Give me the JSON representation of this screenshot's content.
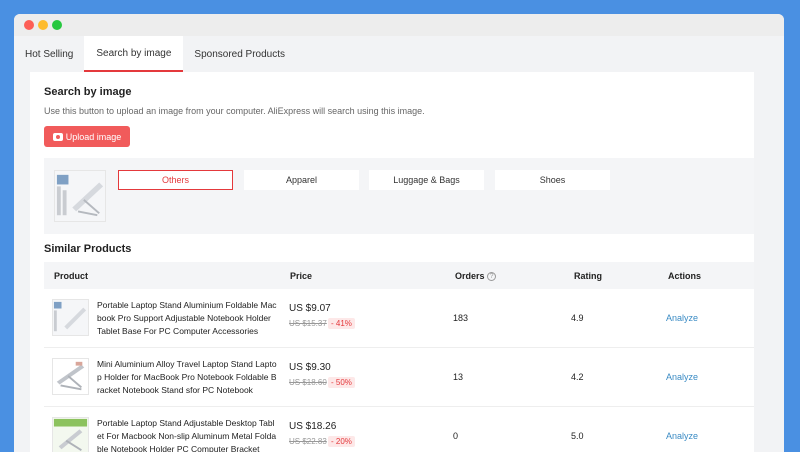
{
  "tabs": [
    {
      "label": "Hot Selling"
    },
    {
      "label": "Search by image"
    },
    {
      "label": "Sponsored Products"
    }
  ],
  "search": {
    "title": "Search by image",
    "description": "Use this button to upload an image from your computer. AliExpress will search using this image.",
    "upload_label": "Upload image"
  },
  "categories": [
    {
      "label": "Others",
      "active": true
    },
    {
      "label": "Apparel"
    },
    {
      "label": "Luggage & Bags"
    },
    {
      "label": "Shoes"
    }
  ],
  "similar": {
    "title": "Similar Products",
    "columns": {
      "product": "Product",
      "price": "Price",
      "orders": "Orders",
      "rating": "Rating",
      "actions": "Actions"
    },
    "rows": [
      {
        "name": "Portable Laptop Stand Aluminium Foldable Macbook Pro Support Adjustable Notebook Holder Tablet Base For PC Computer Accessories",
        "price": "US $9.07",
        "old_price": "US $15.37",
        "discount": "- 41%",
        "orders": "183",
        "rating": "4.9",
        "action": "Analyze"
      },
      {
        "name": "Mini Aluminium Alloy Travel Laptop Stand Laptop Holder for MacBook Pro Notebook Foldable Bracket Notebook Stand sfor PC Notebook",
        "price": "US $9.30",
        "old_price": "US $18.60",
        "discount": "- 50%",
        "orders": "13",
        "rating": "4.2",
        "action": "Analyze"
      },
      {
        "name": "Portable Laptop Stand Adjustable Desktop Tablet For Macbook Non-slip Aluminum Metal Foldable Notebook Holder PC Computer Bracket",
        "price": "US $18.26",
        "old_price": "US $22.83",
        "discount": "- 20%",
        "orders": "0",
        "rating": "5.0",
        "action": "Analyze"
      }
    ]
  },
  "icons": {
    "camera": "camera-icon",
    "question": "question-circle-icon"
  },
  "colors": {
    "accent": "#f15b5b",
    "link": "#3a8bc4",
    "background": "#4a90e2"
  }
}
